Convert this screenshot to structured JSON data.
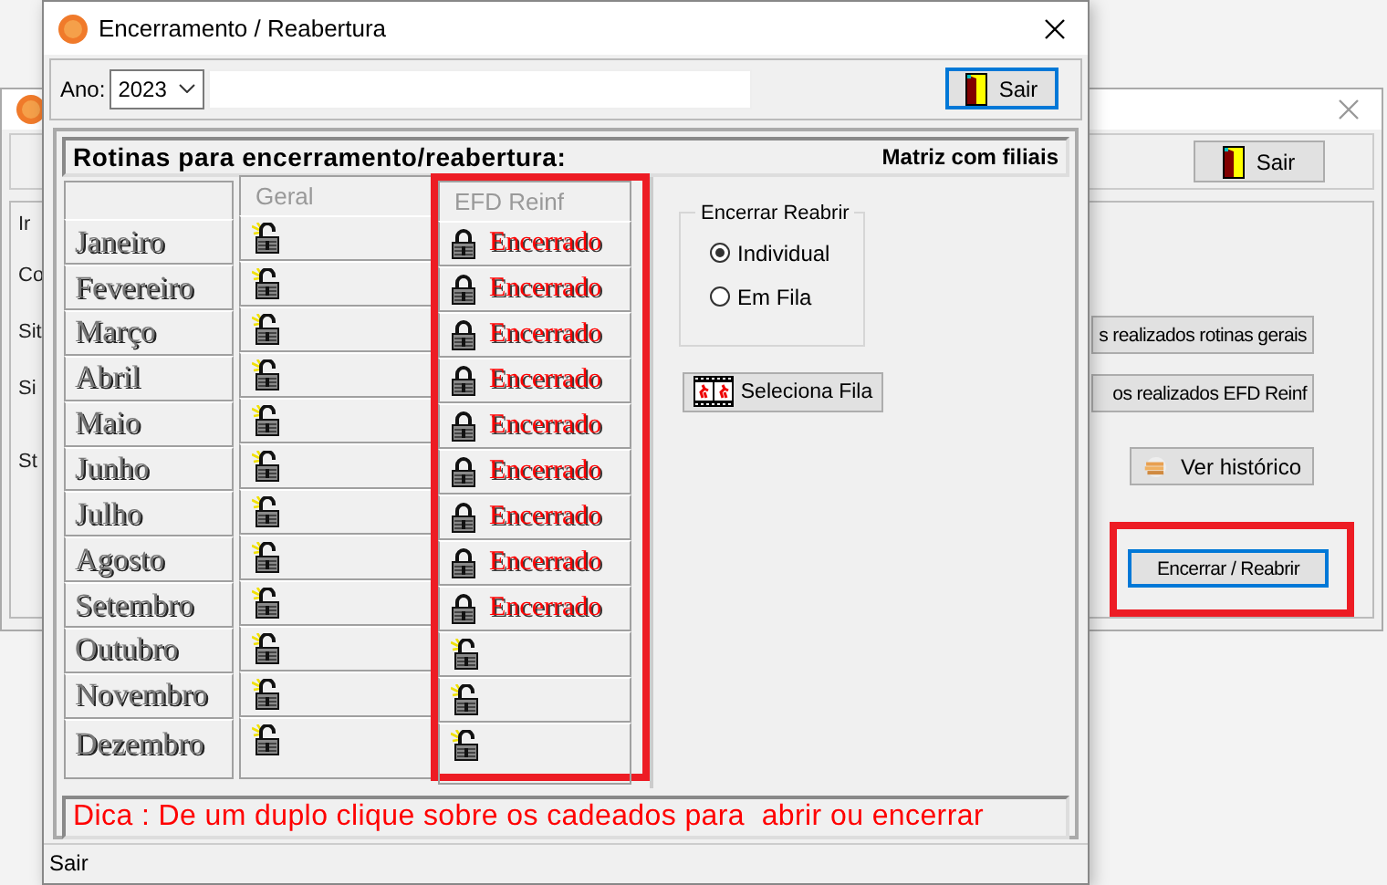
{
  "background_window": {
    "exit_button": "Sair",
    "labels": [
      "Ir",
      "Co",
      "Sit",
      "Si",
      "St"
    ],
    "buttons": [
      {
        "label": "s realizados rotinas gerais",
        "kind": "plain",
        "highlighted": false,
        "focused": false
      },
      {
        "label": "os realizados EFD Reinf",
        "kind": "plain",
        "highlighted": false,
        "focused": false
      },
      {
        "label": "Ver histórico",
        "kind": "history",
        "highlighted": false,
        "focused": false
      },
      {
        "label": "Encerrar / Reabrir",
        "kind": "plain",
        "highlighted": true,
        "focused": true
      }
    ]
  },
  "window": {
    "title": "Encerramento / Reabertura"
  },
  "toolbar": {
    "year_label": "Ano:",
    "year": "2023",
    "exit_button": "Sair",
    "exit_focused": true
  },
  "panel": {
    "title": "Rotinas para encerramento/reabertura:",
    "scope": "Matriz com filiais"
  },
  "table": {
    "columns": [
      {
        "label": "Geral",
        "highlighted": false
      },
      {
        "label": "EFD Reinf",
        "highlighted": true
      }
    ],
    "rows": [
      {
        "month": "Janeiro",
        "cells": [
          {
            "locked": false
          },
          {
            "locked": true,
            "status": "Encerrado"
          }
        ]
      },
      {
        "month": "Fevereiro",
        "cells": [
          {
            "locked": false
          },
          {
            "locked": true,
            "status": "Encerrado"
          }
        ]
      },
      {
        "month": "Março",
        "cells": [
          {
            "locked": false
          },
          {
            "locked": true,
            "status": "Encerrado"
          }
        ]
      },
      {
        "month": "Abril",
        "cells": [
          {
            "locked": false
          },
          {
            "locked": true,
            "status": "Encerrado"
          }
        ]
      },
      {
        "month": "Maio",
        "cells": [
          {
            "locked": false
          },
          {
            "locked": true,
            "status": "Encerrado"
          }
        ]
      },
      {
        "month": "Junho",
        "cells": [
          {
            "locked": false
          },
          {
            "locked": true,
            "status": "Encerrado"
          }
        ]
      },
      {
        "month": "Julho",
        "cells": [
          {
            "locked": false
          },
          {
            "locked": true,
            "status": "Encerrado"
          }
        ]
      },
      {
        "month": "Agosto",
        "cells": [
          {
            "locked": false
          },
          {
            "locked": true,
            "status": "Encerrado"
          }
        ]
      },
      {
        "month": "Setembro",
        "cells": [
          {
            "locked": false
          },
          {
            "locked": true,
            "status": "Encerrado"
          }
        ]
      },
      {
        "month": "Outubro",
        "cells": [
          {
            "locked": false
          },
          {
            "locked": false
          }
        ]
      },
      {
        "month": "Novembro",
        "cells": [
          {
            "locked": false
          },
          {
            "locked": false
          }
        ]
      },
      {
        "month": "Dezembro",
        "cells": [
          {
            "locked": false
          },
          {
            "locked": false
          }
        ]
      }
    ]
  },
  "mode_group": {
    "title": "Encerrar Reabrir",
    "options": [
      {
        "label": "Individual",
        "selected": true
      },
      {
        "label": "Em Fila",
        "selected": false
      }
    ]
  },
  "queue_button": "Seleciona Fila",
  "tip": "Dica : De um duplo clique sobre os cadeados para  abrir ou encerrar",
  "status_bar": "Sair"
}
